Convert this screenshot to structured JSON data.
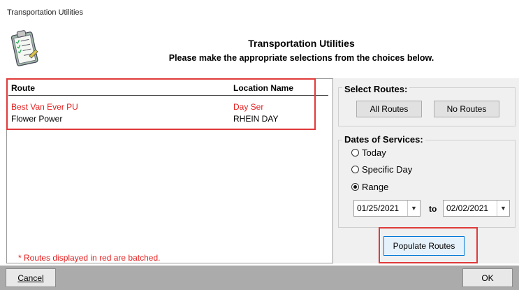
{
  "window": {
    "title": "Transportation Utilities"
  },
  "header": {
    "title": "Transportation Utilities",
    "subtitle": "Please make the appropriate selections from the choices below."
  },
  "route_list": {
    "columns": [
      "Route",
      "Location Name"
    ],
    "rows": [
      {
        "route": "Best Van Ever PU",
        "location": "Day Ser",
        "batched": true
      },
      {
        "route": "Flower Power",
        "location": "RHEIN DAY",
        "batched": false
      }
    ],
    "note": "* Routes displayed in red are batched."
  },
  "select_routes": {
    "title": "Select Routes:",
    "all_label": "All Routes",
    "none_label": "No Routes"
  },
  "dates": {
    "title": "Dates of Services:",
    "options": [
      "Today",
      "Specific Day",
      "Range"
    ],
    "selected": "Range",
    "from": "01/25/2021",
    "to_label": "to",
    "to": "02/02/2021"
  },
  "populate_label": "Populate Routes",
  "footer": {
    "cancel_label": "Cancel",
    "ok_label": "OK"
  },
  "colors": {
    "batched": "#e41f1f",
    "highlight": "#e03a3a",
    "accent": "#0078d7"
  },
  "icons": {
    "dialog": "clipboard-checklist-icon",
    "dropdown": "chevron-down-icon"
  }
}
